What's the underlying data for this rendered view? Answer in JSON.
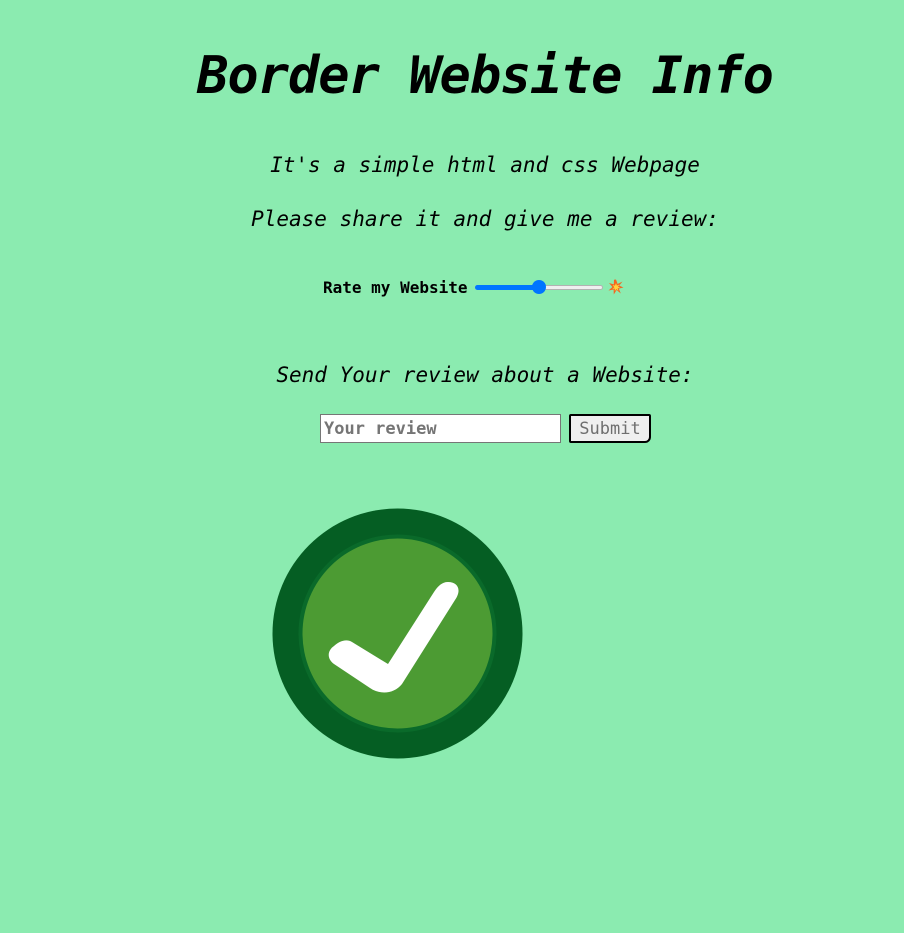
{
  "header": {
    "title": "Border Website Info"
  },
  "intro": {
    "line1": "It's a simple html and css Webpage",
    "line2": "Please share it and give me a review:"
  },
  "rating": {
    "label": "Rate my Website",
    "value": 50,
    "min": 0,
    "max": 100,
    "icon": "collision-burst-icon",
    "accent_color": "#0075ff"
  },
  "review": {
    "heading": "Send Your review about a Website:",
    "input_placeholder": "Your review",
    "input_value": "",
    "submit_label": "Submit"
  },
  "badge": {
    "icon": "checkmark-circle-icon",
    "outer_color": "#055e23",
    "inner_color": "#4c9b33",
    "check_color": "#ffffff"
  },
  "colors": {
    "background": "#8bebb0"
  }
}
